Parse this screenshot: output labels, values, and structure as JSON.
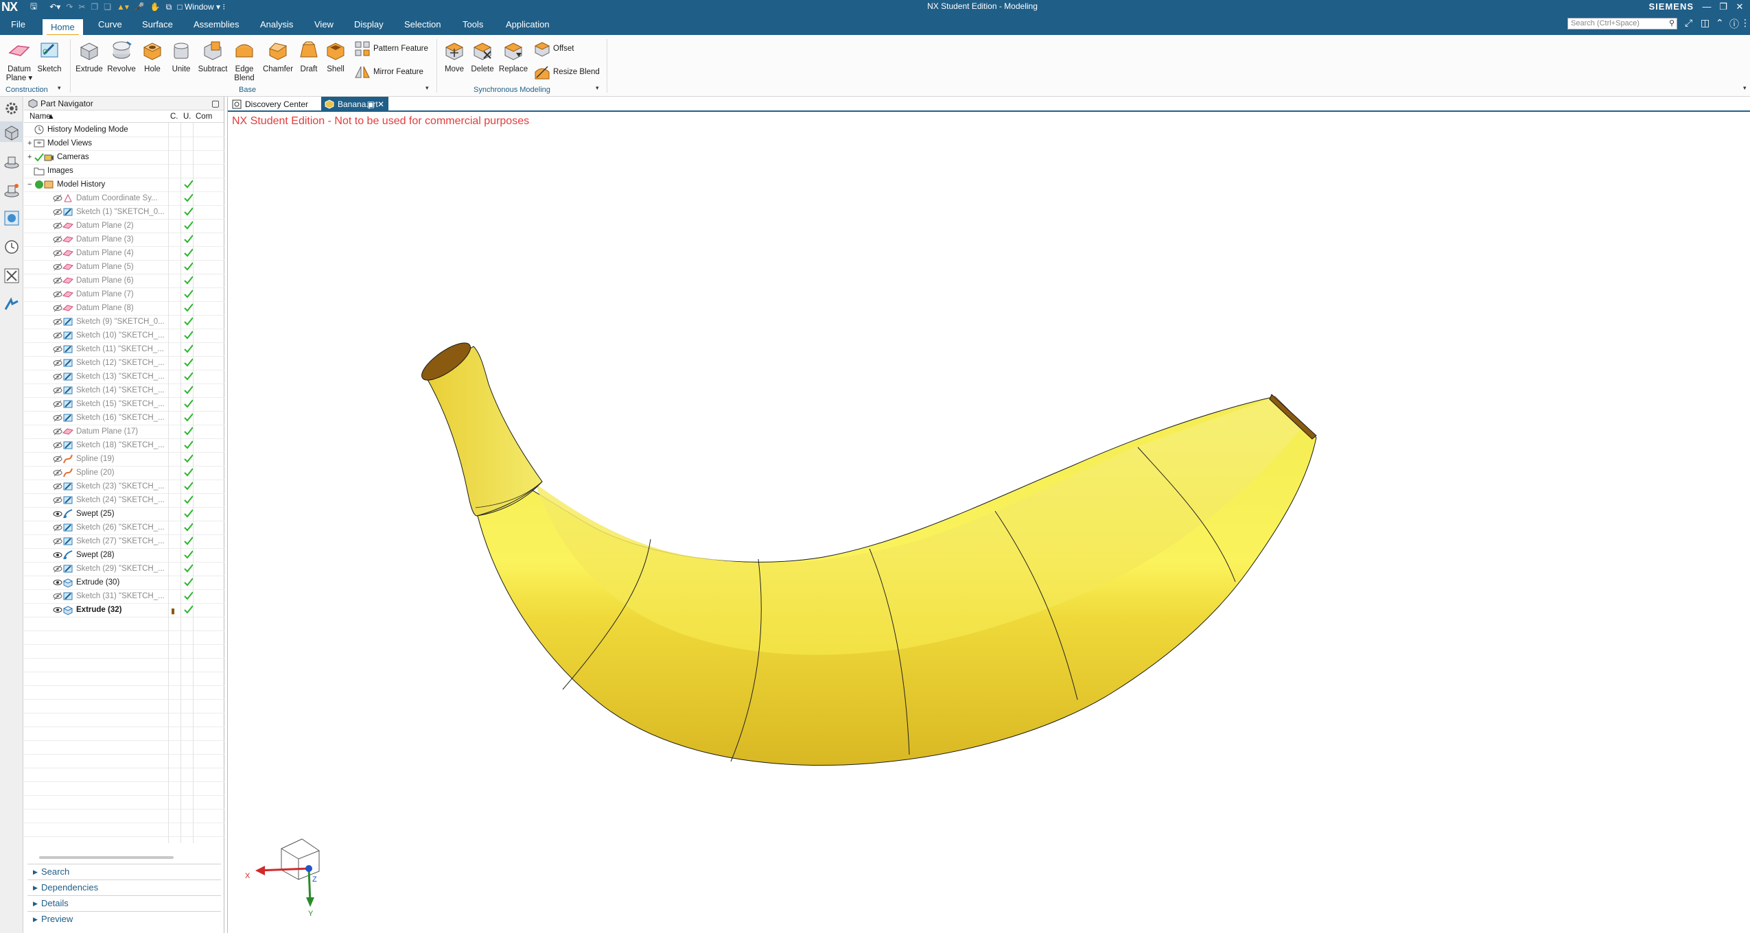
{
  "titlebar": {
    "logo": "NX",
    "window_menu": "Window",
    "title": "NX Student Edition - Modeling",
    "brand": "SIEMENS"
  },
  "menu": {
    "tabs": [
      "File",
      "Home",
      "Curve",
      "Surface",
      "Assemblies",
      "Analysis",
      "View",
      "Display",
      "Selection",
      "Tools",
      "Application"
    ],
    "active": "Home",
    "search_placeholder": "Search (Ctrl+Space)"
  },
  "ribbon": {
    "construction": {
      "datum_plane": "Datum",
      "datum_plane2": "Plane",
      "sketch": "Sketch",
      "label": "Construction"
    },
    "base": {
      "extrude": "Extrude",
      "revolve": "Revolve",
      "hole": "Hole",
      "unite": "Unite",
      "subtract": "Subtract",
      "edge_blend": "Edge",
      "edge_blend2": "Blend",
      "chamfer": "Chamfer",
      "draft": "Draft",
      "shell": "Shell",
      "pattern_feature": "Pattern Feature",
      "mirror_feature": "Mirror Feature",
      "label": "Base"
    },
    "sync": {
      "move": "Move",
      "delete": "Delete",
      "replace": "Replace",
      "offset": "Offset",
      "resize_blend": "Resize Blend",
      "label": "Synchronous Modeling"
    }
  },
  "navigator": {
    "title": "Part Navigator",
    "columns": {
      "name": "Name",
      "c": "C.",
      "u": "U.",
      "com": "Com"
    },
    "top_items": [
      "History Modeling Mode",
      "Model Views",
      "Cameras",
      "Images",
      "Model History"
    ],
    "features": [
      {
        "label": "Datum Coordinate Sy...",
        "type": "csys",
        "shown": false
      },
      {
        "label": "Sketch (1) \"SKETCH_0...",
        "type": "sketch",
        "shown": false
      },
      {
        "label": "Datum Plane (2)",
        "type": "plane",
        "shown": false
      },
      {
        "label": "Datum Plane (3)",
        "type": "plane",
        "shown": false
      },
      {
        "label": "Datum Plane (4)",
        "type": "plane",
        "shown": false
      },
      {
        "label": "Datum Plane (5)",
        "type": "plane",
        "shown": false
      },
      {
        "label": "Datum Plane (6)",
        "type": "plane",
        "shown": false
      },
      {
        "label": "Datum Plane (7)",
        "type": "plane",
        "shown": false
      },
      {
        "label": "Datum Plane (8)",
        "type": "plane",
        "shown": false
      },
      {
        "label": "Sketch (9) \"SKETCH_0...",
        "type": "sketch",
        "shown": false
      },
      {
        "label": "Sketch (10) \"SKETCH_...",
        "type": "sketch",
        "shown": false
      },
      {
        "label": "Sketch (11) \"SKETCH_...",
        "type": "sketch",
        "shown": false
      },
      {
        "label": "Sketch (12) \"SKETCH_...",
        "type": "sketch",
        "shown": false
      },
      {
        "label": "Sketch (13) \"SKETCH_...",
        "type": "sketch",
        "shown": false
      },
      {
        "label": "Sketch (14) \"SKETCH_...",
        "type": "sketch",
        "shown": false
      },
      {
        "label": "Sketch (15) \"SKETCH_...",
        "type": "sketch",
        "shown": false
      },
      {
        "label": "Sketch (16) \"SKETCH_...",
        "type": "sketch",
        "shown": false
      },
      {
        "label": "Datum Plane (17)",
        "type": "plane",
        "shown": false
      },
      {
        "label": "Sketch (18) \"SKETCH_...",
        "type": "sketch",
        "shown": false
      },
      {
        "label": "Spline (19)",
        "type": "spline",
        "shown": false
      },
      {
        "label": "Spline (20)",
        "type": "spline",
        "shown": false
      },
      {
        "label": "Sketch (23) \"SKETCH_...",
        "type": "sketch",
        "shown": false
      },
      {
        "label": "Sketch (24) \"SKETCH_...",
        "type": "sketch",
        "shown": false
      },
      {
        "label": "Swept (25)",
        "type": "swept",
        "shown": true
      },
      {
        "label": "Sketch (26) \"SKETCH_...",
        "type": "sketch",
        "shown": false
      },
      {
        "label": "Sketch (27) \"SKETCH_...",
        "type": "sketch",
        "shown": false
      },
      {
        "label": "Swept (28)",
        "type": "swept",
        "shown": true
      },
      {
        "label": "Sketch (29) \"SKETCH_...",
        "type": "sketch",
        "shown": false
      },
      {
        "label": "Extrude (30)",
        "type": "extrude",
        "shown": true
      },
      {
        "label": "Sketch (31) \"SKETCH_...",
        "type": "sketch",
        "shown": false
      },
      {
        "label": "Extrude (32)",
        "type": "extrude",
        "shown": true,
        "current": true
      }
    ],
    "panels": [
      "Search",
      "Dependencies",
      "Details",
      "Preview"
    ]
  },
  "graphics": {
    "tabs": [
      "Discovery Center",
      "Banana.prt"
    ],
    "active_tab": "Banana.prt",
    "watermark": "NX Student Edition - Not to be used for commercial purposes",
    "triad": {
      "x": "X",
      "y": "Y",
      "z": "Z"
    }
  },
  "colors": {
    "titlebar": "#1f5e87",
    "accent": "#e7a31b",
    "banana": "#f2e23a",
    "banana_tip": "#8a5a10",
    "watermark": "#e23c3c",
    "check": "#2bb52b"
  }
}
